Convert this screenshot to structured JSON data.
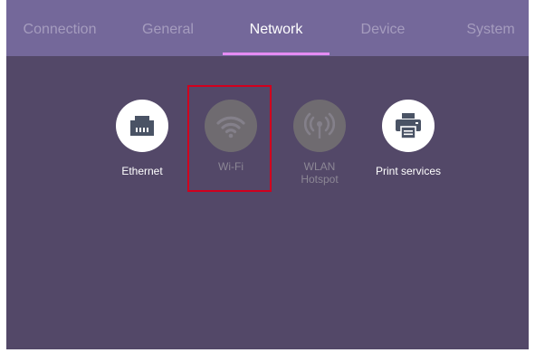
{
  "tabs": [
    {
      "label": "Connection",
      "active": false
    },
    {
      "label": "General",
      "active": false
    },
    {
      "label": "Network",
      "active": true
    },
    {
      "label": "Device",
      "active": false
    },
    {
      "label": "System",
      "active": false
    }
  ],
  "items": [
    {
      "label": "Ethernet",
      "icon": "ethernet-port-icon",
      "enabled": true
    },
    {
      "label": "Wi-Fi",
      "icon": "wifi-icon",
      "enabled": false
    },
    {
      "label": "WLAN\nHotspot",
      "icon": "hotspot-icon",
      "enabled": false
    },
    {
      "label": "Print services",
      "icon": "printer-icon",
      "enabled": true
    }
  ],
  "colors": {
    "background": "#534868",
    "tabbar": "#74689a",
    "active_underline": "#e58cf3",
    "highlight": "#d1001e"
  }
}
